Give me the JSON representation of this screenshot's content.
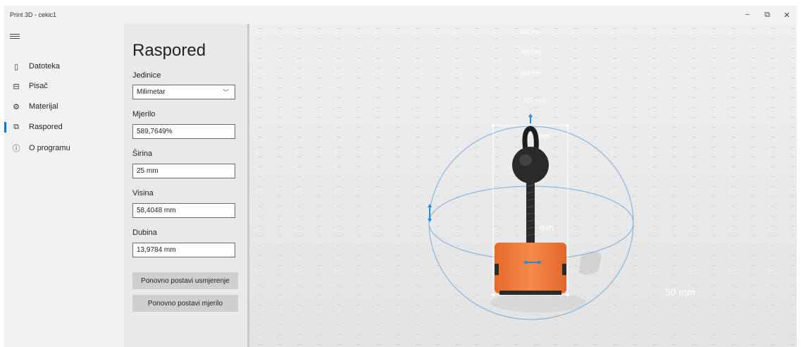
{
  "window": {
    "title": "Print 3D - cekic1",
    "minimize": "−",
    "restore": "⧉",
    "close": "✕"
  },
  "nav": {
    "items": [
      {
        "label": "Datoteka",
        "icon": "file-icon",
        "glyph": "▯"
      },
      {
        "label": "Pisač",
        "icon": "printer-icon",
        "glyph": "⊟"
      },
      {
        "label": "Materijal",
        "icon": "palette-icon",
        "glyph": "⚙"
      },
      {
        "label": "Raspored",
        "icon": "layout-icon",
        "glyph": "⧉"
      },
      {
        "label": "O programu",
        "icon": "info-icon",
        "glyph": "ⓘ"
      }
    ],
    "active": "Raspored"
  },
  "panel": {
    "title": "Raspored",
    "units": {
      "label": "Jedinice",
      "value": "Milimetar"
    },
    "scale": {
      "label": "Mjerilo",
      "value": "589,7649%"
    },
    "width": {
      "label": "Širina",
      "value": "25 mm"
    },
    "height": {
      "label": "Visina",
      "value": "58,4048 mm"
    },
    "depth": {
      "label": "Dubina",
      "value": "13,9784 mm"
    },
    "reset_orientation": "Ponovno postavi usmjerenje",
    "reset_scale": "Ponovno postavi mjerilo"
  },
  "viewport": {
    "ruler_labels": [
      "400 mm",
      "300 mm",
      "250 mm",
      "200 mm",
      "0 mm",
      "mm",
      "mm"
    ],
    "floor_label": "50 mm",
    "accent": "#1e88e5",
    "model_color": "#f07a3a"
  }
}
